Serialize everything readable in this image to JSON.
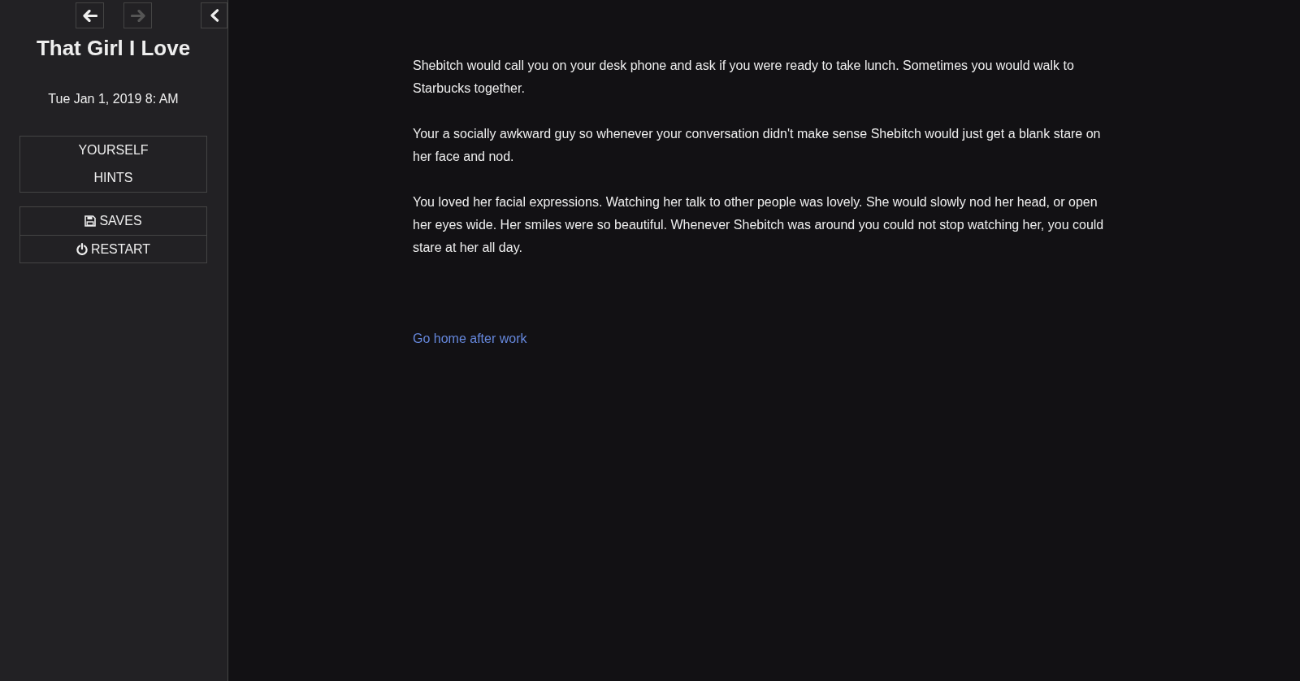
{
  "nav_buttons": [
    {
      "kind": "back",
      "disabled": false
    },
    {
      "kind": "forward",
      "disabled": true
    }
  ],
  "sidebar_toggle": {
    "expanded": true
  },
  "story_title": "That Girl I Love",
  "story_date": "Tue Jan 1, 2019 8: AM",
  "story_menu": [
    "YOURSELF",
    "HINTS"
  ],
  "core_menu": [
    {
      "kind": "saves",
      "label": "SAVES"
    },
    {
      "kind": "restart",
      "label": "RESTART"
    }
  ],
  "passage": {
    "paragraphs": [
      "Shebitch would call you on your desk phone and ask if you were ready to take lunch. Sometimes you would walk to Starbucks together.",
      "Your a socially awkward guy so whenever your conversation didn't make sense Shebitch would just get a blank stare on her face and nod.",
      "You loved her facial expressions. Watching her talk to other people was lovely. She would slowly nod her head, or open her eyes wide. Her smiles were so beautiful. Whenever Shebitch was around you could not stop watching her, you could stare at her all day."
    ],
    "links": [
      "Go home after work"
    ]
  }
}
